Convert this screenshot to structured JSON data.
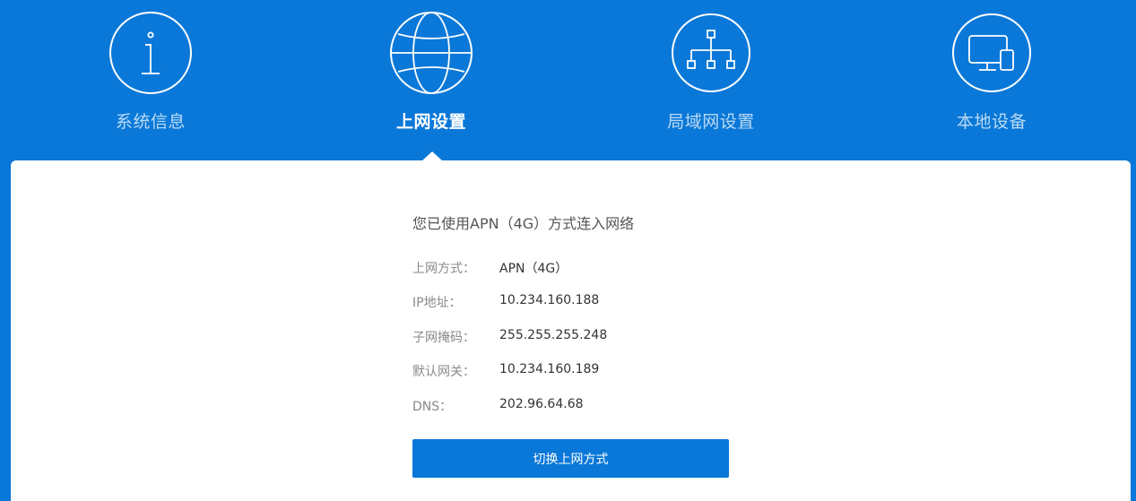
{
  "nav": {
    "items": [
      {
        "label": "系统信息",
        "icon": "info-icon",
        "active": false
      },
      {
        "label": "上网设置",
        "icon": "globe-icon",
        "active": true
      },
      {
        "label": "局域网设置",
        "icon": "network-tree-icon",
        "active": false
      },
      {
        "label": "本地设备",
        "icon": "devices-icon",
        "active": false
      }
    ]
  },
  "content": {
    "status": "您已使用APN（4G）方式连入网络",
    "rows": [
      {
        "key": "上网方式：",
        "value": "APN（4G）"
      },
      {
        "key": "IP地址：",
        "value": "10.234.160.188"
      },
      {
        "key": "子网掩码：",
        "value": "255.255.255.248"
      },
      {
        "key": "默认网关：",
        "value": "10.234.160.189"
      },
      {
        "key": "DNS：",
        "value": "202.96.64.68"
      }
    ],
    "switch_button": "切换上网方式"
  },
  "colors": {
    "brand_blue": "#0a78d8",
    "card_bg": "#ffffff"
  }
}
